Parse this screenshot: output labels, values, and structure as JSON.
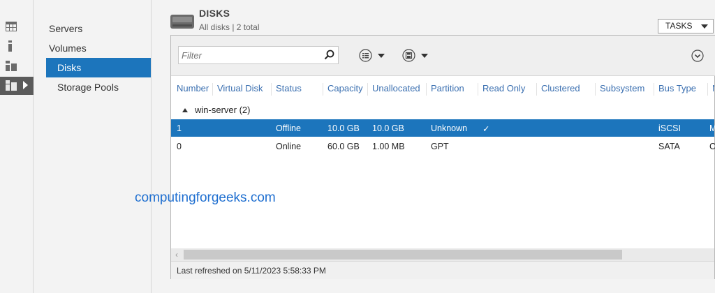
{
  "rail": {
    "items": [
      {
        "icon": "dashboard-icon"
      },
      {
        "icon": "local-server-icon"
      },
      {
        "icon": "all-servers-icon"
      },
      {
        "icon": "file-storage-icon"
      }
    ]
  },
  "nav": {
    "items": [
      {
        "label": "Servers"
      },
      {
        "label": "Volumes"
      },
      {
        "label": "Disks"
      },
      {
        "label": "Storage Pools"
      }
    ]
  },
  "header": {
    "title": "DISKS",
    "subtitle": "All disks | 2 total",
    "tasks_label": "TASKS"
  },
  "toolbar": {
    "filter_placeholder": "Filter"
  },
  "table": {
    "columns": [
      "Number",
      "Virtual Disk",
      "Status",
      "Capacity",
      "Unallocated",
      "Partition",
      "Read Only",
      "Clustered",
      "Subsystem",
      "Bus Type",
      "N"
    ],
    "group_label": "win-server (2)",
    "rows": [
      {
        "number": "1",
        "virtual_disk": "",
        "status": "Offline",
        "capacity": "10.0 GB",
        "unallocated": "10.0 GB",
        "partition": "Unknown",
        "read_only": "✓",
        "clustered": "",
        "subsystem": "",
        "bus_type": "iSCSI",
        "extra": "M"
      },
      {
        "number": "0",
        "virtual_disk": "",
        "status": "Online",
        "capacity": "60.0 GB",
        "unallocated": "1.00 MB",
        "partition": "GPT",
        "read_only": "",
        "clustered": "",
        "subsystem": "",
        "bus_type": "SATA",
        "extra": "C"
      }
    ]
  },
  "footer": {
    "last_refreshed": "Last refreshed on 5/11/2023 5:58:33 PM"
  },
  "watermark": "computingforgeeks.com",
  "colors": {
    "accent": "#1c75bc",
    "header_text": "#3a6fb0"
  }
}
